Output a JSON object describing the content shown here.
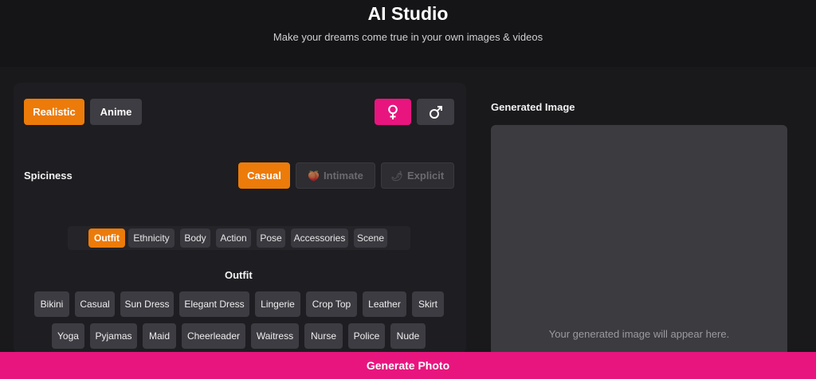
{
  "header": {
    "title": "AI Studio",
    "subtitle": "Make your dreams come true in your own images & videos"
  },
  "style_toggle": {
    "realistic": "Realistic",
    "anime": "Anime"
  },
  "gender": {
    "female_icon": "female-symbol",
    "male_icon": "male-symbol"
  },
  "spiciness": {
    "label": "Spiciness",
    "casual": "Casual",
    "intimate": "Intimate",
    "explicit": "Explicit"
  },
  "tabs": [
    "Outfit",
    "Ethnicity",
    "Body",
    "Action",
    "Pose",
    "Accessories",
    "Scene"
  ],
  "outfit": {
    "heading": "Outfit",
    "row1": [
      "Bikini",
      "Casual",
      "Sun Dress",
      "Elegant Dress",
      "Lingerie",
      "Crop Top",
      "Leather",
      "Skirt"
    ],
    "row2": [
      "Yoga",
      "Pyjamas",
      "Maid",
      "Cheerleader",
      "Waitress",
      "Nurse",
      "Police",
      "Nude"
    ]
  },
  "preview": {
    "label": "Generated Image",
    "placeholder": "Your generated image will appear here."
  },
  "generate_button": "Generate Photo",
  "colors": {
    "accent_orange": "#ec7b0a",
    "accent_pink": "#e8157f",
    "background": "#19181b"
  }
}
